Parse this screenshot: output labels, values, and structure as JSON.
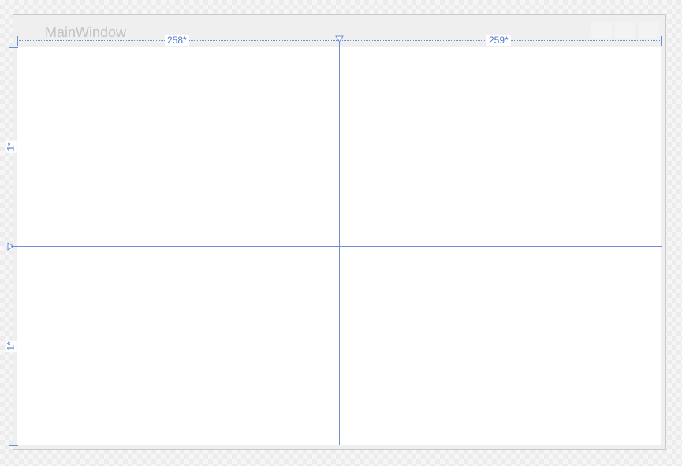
{
  "window": {
    "title": "MainWindow"
  },
  "grid": {
    "columns": [
      {
        "label": "258*",
        "name": "column-0"
      },
      {
        "label": "259*",
        "name": "column-1"
      }
    ],
    "rows": [
      {
        "label": "1*",
        "name": "row-0"
      },
      {
        "label": "1*",
        "name": "row-1"
      }
    ]
  },
  "colors": {
    "guide": "#6d8fd6",
    "label": "#4f78cc",
    "title": "#c2c2c2"
  }
}
